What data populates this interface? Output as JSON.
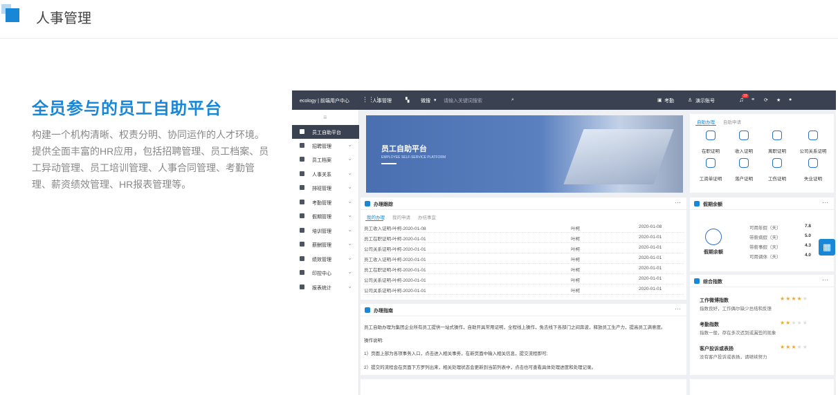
{
  "header": {
    "title": "人事管理"
  },
  "hero": {
    "title": "全员参与的员工自助平台",
    "description": "构建一个机构清晰、权责分明、协同运作的人才环境。提供全面丰富的HR应用，包括招聘管理、员工档案、员工异动管理、员工培训管理、人事合同管理、考勤管理、薪资绩效管理、HR报表管理等。"
  },
  "app": {
    "brand": "ecology | 前端用户中心",
    "module": "人事管理",
    "scope": "微搜",
    "search_placeholder": "请输入关键词搜索",
    "attendance": "考勤",
    "account": "演示账号",
    "notification_count": "10",
    "sidebar": [
      {
        "label": "员工自助平台",
        "active": true
      },
      {
        "label": "招聘管理"
      },
      {
        "label": "员工档案"
      },
      {
        "label": "人事关系"
      },
      {
        "label": "排班管理"
      },
      {
        "label": "考勤管理"
      },
      {
        "label": "假期管理"
      },
      {
        "label": "培训管理"
      },
      {
        "label": "薪酬管理"
      },
      {
        "label": "绩效管理"
      },
      {
        "label": "印控中心"
      },
      {
        "label": "报表统计"
      }
    ],
    "banner": {
      "title": "员工自助平台",
      "subtitle": "EMPLOYEE SELF-SERVICE PLATFORM"
    },
    "services": {
      "tabs": [
        "自助办理",
        "自助申请"
      ],
      "items": [
        "在职证明",
        "收入证明",
        "离职证明",
        "公司关系证明",
        "工资单证明",
        "落户证明",
        "工伤证明",
        "失业证明"
      ]
    },
    "tracking": {
      "title": "办理跟踪",
      "tabs": [
        "我的办理",
        "我的申请",
        "办结事宜"
      ],
      "rows": [
        {
          "name": "员工收入证明-叶柯-2020-01-08",
          "user": "叶柯",
          "date": "2020-01-08"
        },
        {
          "name": "员工在职证明-叶柯-2020-01-01",
          "user": "叶柯",
          "date": "2020-01-01"
        },
        {
          "name": "公司关系证明-叶柯-2020-01-01",
          "user": "叶柯",
          "date": "2020-01-01"
        },
        {
          "name": "员工收入证明-叶柯-2020-01-01",
          "user": "叶柯",
          "date": "2020-01-01"
        },
        {
          "name": "员工在职证明-叶柯-2020-01-01",
          "user": "叶柯",
          "date": "2020-01-01"
        },
        {
          "name": "公司关系证明-叶柯-2020-01-01",
          "user": "叶柯",
          "date": "2020-01-01"
        },
        {
          "name": "公司关系证明-叶柯-2020-01-01",
          "user": "叶柯",
          "date": "2020-01-01"
        }
      ]
    },
    "leave": {
      "title": "假期余额",
      "icon_label": "假期余额",
      "rows": [
        {
          "label": "可用年假（天）",
          "value": "7.8"
        },
        {
          "label": "带薪病假（天）",
          "value": "5.0"
        },
        {
          "label": "带薪事假（天）",
          "value": "4.3"
        },
        {
          "label": "可用调休（天）",
          "value": "4.0"
        }
      ]
    },
    "guide": {
      "title": "办理指南",
      "intro": "员工自助办理为集团企业所有员工提供一站式操作，自助开具常用证明，全程线上操作，免去线下各部门之间奔波，释放员工生产力，提高员工满意度。",
      "label": "操作说明:",
      "step1": "1）页面上部为各项事务入口，点击进入相关事务，在新页面中输入相关信息，提交流程即可;",
      "step2": "2）提交的流程会在页面下方罗列出来，相关处理状态会更新到当前列表中，点击也可查看具体处理进度和处理记录。"
    },
    "index": {
      "title": "综合指数",
      "items": [
        {
          "name": "工作微博指数",
          "desc": "指数良好，工作偶尔缺少总结和反馈",
          "stars": 4
        },
        {
          "name": "考勤指数",
          "desc": "指数一般，存在多次迟到或漏签的现象",
          "stars": 2
        },
        {
          "name": "客户投诉或表扬",
          "desc": "没有客户投诉或表扬，请继续努力",
          "stars": 3
        }
      ]
    }
  }
}
